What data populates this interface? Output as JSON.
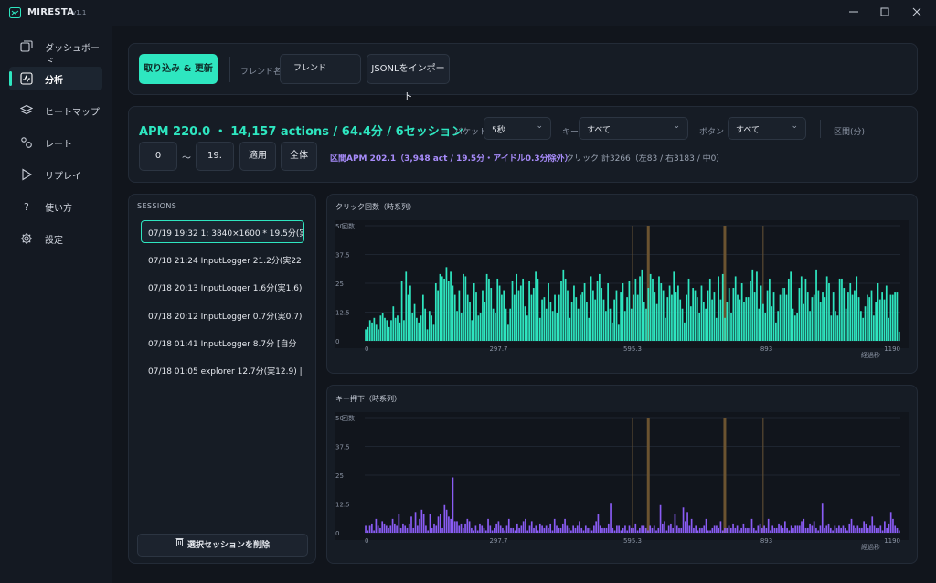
{
  "app": {
    "name": "MIRESTA",
    "version": "v1.1"
  },
  "sidebar": {
    "items": [
      {
        "label": "ダッシュボード",
        "icon": "dashboard-icon"
      },
      {
        "label": "分析",
        "icon": "analysis-icon",
        "active": true
      },
      {
        "label": "ヒートマップ",
        "icon": "layers-icon"
      },
      {
        "label": "レート",
        "icon": "rate-icon"
      },
      {
        "label": "リプレイ",
        "icon": "play-icon"
      },
      {
        "label": "使い方",
        "icon": "help-icon"
      },
      {
        "label": "設定",
        "icon": "gear-icon"
      }
    ]
  },
  "toolbar": {
    "import_button": "取り込み & 更新",
    "friend_label": "フレンド名",
    "friend_value": "フレンド",
    "jsonl_button": "JSONLをインポート"
  },
  "stats": {
    "summary": "APM 220.0 ・ 14,157 actions / 64.4分 / 6セッション",
    "bucket_label": "バケット",
    "bucket_value": "5秒",
    "key_label": "キー",
    "key_value": "すべて",
    "button_label": "ボタン",
    "button_value": "すべて",
    "range_label": "区間(分)",
    "range_from": "0",
    "range_sep": "〜",
    "range_to": "19.",
    "apply_button": "適用",
    "all_button": "全体",
    "range_apm": "区間APM 202.1（3,948 act / 19.5分・アイドル0.3分除外）",
    "click_total": "クリック 計3266（左83 / 右3183 / 中0）"
  },
  "sessions": {
    "title": "SESSIONS",
    "items": [
      "07/19 19:32  1: 3840×1600 *  19.5分(実",
      "07/18 21:24  InputLogger  21.2分(実22",
      "07/18 20:13  InputLogger  1.6分(実1.6)",
      "07/18 20:12  InputLogger  0.7分(実0.7)",
      "07/18 01:41  InputLogger  8.7分  [自分",
      "07/18 01:05  explorer  12.7分(実12.9)  |"
    ],
    "selected_index": 0,
    "delete_button": "選択セッションを削除"
  },
  "chart_data": [
    {
      "type": "bar",
      "title": "クリック回数（時系列）",
      "ylabel": "回数",
      "xlabel": "経過秒",
      "ylim": [
        0,
        50
      ],
      "yticks": [
        "0",
        "12.5",
        "25",
        "37.5",
        "50"
      ],
      "xlim": [
        0,
        1190
      ],
      "xticks": [
        "0",
        "297.7",
        "595.3",
        "893",
        "1190"
      ],
      "bar_color": "#2ee6c0",
      "idle_markers_seconds": [
        595,
        630,
        800,
        885
      ],
      "values": [
        5,
        6,
        9,
        8,
        10,
        7,
        5,
        11,
        12,
        10,
        9,
        6,
        9,
        15,
        10,
        11,
        8,
        26,
        9,
        30,
        20,
        24,
        12,
        16,
        10,
        8,
        11,
        20,
        14,
        5,
        13,
        11,
        7,
        25,
        22,
        29,
        28,
        27,
        32,
        26,
        30,
        24,
        20,
        13,
        22,
        12,
        29,
        28,
        20,
        17,
        9,
        25,
        21,
        11,
        12,
        22,
        17,
        29,
        27,
        23,
        14,
        12,
        27,
        24,
        20,
        22,
        14,
        7,
        14,
        26,
        20,
        29,
        22,
        24,
        27,
        15,
        11,
        26,
        20,
        23,
        30,
        27,
        10,
        18,
        19,
        14,
        25,
        17,
        13,
        20,
        12,
        20,
        26,
        31,
        27,
        22,
        10,
        17,
        24,
        19,
        14,
        20,
        21,
        25,
        17,
        10,
        28,
        22,
        18,
        26,
        29,
        23,
        18,
        13,
        25,
        14,
        8,
        18,
        22,
        7,
        21,
        25,
        13,
        19,
        26,
        14,
        20,
        27,
        20,
        28,
        31,
        17,
        14,
        23,
        29,
        27,
        21,
        16,
        28,
        25,
        22,
        10,
        19,
        24,
        20,
        30,
        21,
        24,
        18,
        14,
        8,
        20,
        27,
        15,
        23,
        22,
        19,
        12,
        24,
        17,
        14,
        22,
        27,
        18,
        21,
        10,
        28,
        18,
        29,
        10,
        17,
        23,
        12,
        23,
        28,
        20,
        18,
        25,
        17,
        19,
        19,
        26,
        31,
        21,
        30,
        14,
        24,
        16,
        12,
        22,
        27,
        15,
        21,
        8,
        13,
        20,
        23,
        23,
        20,
        27,
        30,
        14,
        11,
        12,
        23,
        28,
        16,
        27,
        21,
        13,
        19,
        20,
        31,
        22,
        17,
        21,
        19,
        28,
        25,
        11,
        21,
        13,
        11,
        27,
        27,
        23,
        14,
        21,
        25,
        20,
        22,
        28,
        19,
        13,
        10,
        15,
        20,
        19,
        22,
        11,
        17,
        25,
        18,
        21,
        18,
        24,
        10,
        20,
        20,
        21,
        21,
        4
      ]
    },
    {
      "type": "bar",
      "title": "キー押下（時系列）",
      "ylabel": "回数",
      "xlabel": "経過秒",
      "ylim": [
        0,
        50
      ],
      "yticks": [
        "0",
        "12.5",
        "25",
        "37.5",
        "50"
      ],
      "xlim": [
        0,
        1190
      ],
      "xticks": [
        "0",
        "297.7",
        "595.3",
        "893",
        "1190"
      ],
      "bar_color": "#8a5cf5",
      "idle_markers_seconds": [
        595,
        630,
        800,
        885
      ],
      "values": [
        3,
        1,
        3,
        4,
        1,
        6,
        3,
        2,
        5,
        4,
        3,
        2,
        3,
        6,
        4,
        3,
        8,
        2,
        4,
        3,
        2,
        4,
        7,
        2,
        9,
        3,
        6,
        10,
        8,
        3,
        1,
        8,
        2,
        4,
        3,
        7,
        8,
        2,
        12,
        10,
        7,
        6,
        24,
        5,
        5,
        3,
        4,
        2,
        4,
        6,
        5,
        2,
        1,
        3,
        1,
        4,
        3,
        2,
        1,
        6,
        3,
        1,
        2,
        4,
        5,
        3,
        2,
        1,
        3,
        6,
        2,
        2,
        1,
        4,
        2,
        3,
        5,
        6,
        1,
        3,
        5,
        2,
        3,
        1,
        4,
        3,
        2,
        3,
        2,
        4,
        1,
        6,
        3,
        2,
        2,
        4,
        6,
        3,
        2,
        1,
        3,
        2,
        3,
        5,
        2,
        1,
        3,
        2,
        2,
        1,
        3,
        5,
        8,
        3,
        2,
        2,
        2,
        4,
        13,
        2,
        1,
        3,
        3,
        1,
        2,
        3,
        1,
        3,
        2,
        2,
        4,
        1,
        2,
        3,
        3,
        2,
        1,
        3,
        2,
        3,
        1,
        2,
        12,
        4,
        5,
        1,
        3,
        4,
        2,
        8,
        3,
        2,
        2,
        11,
        5,
        9,
        3,
        6,
        2,
        3,
        1,
        2,
        2,
        3,
        6,
        1,
        1,
        2,
        3,
        3,
        2,
        5,
        1,
        2,
        2,
        3,
        2,
        4,
        2,
        3,
        1,
        2,
        4,
        2,
        2,
        2,
        6,
        2,
        1,
        3,
        4,
        2,
        3,
        2,
        6,
        1,
        3,
        2,
        2,
        4,
        3,
        2,
        5,
        2,
        1,
        3,
        2,
        3,
        3,
        3,
        5,
        6,
        2,
        2,
        4,
        3,
        5,
        2,
        1,
        3,
        13,
        2,
        3,
        4,
        2,
        1,
        3,
        2,
        3,
        2,
        3,
        2,
        1,
        4,
        6,
        3,
        2,
        3,
        2,
        2,
        5,
        4,
        2,
        3,
        7,
        3,
        2,
        2,
        3,
        1,
        5,
        2,
        4,
        9,
        6,
        3,
        2,
        1
      ]
    }
  ]
}
